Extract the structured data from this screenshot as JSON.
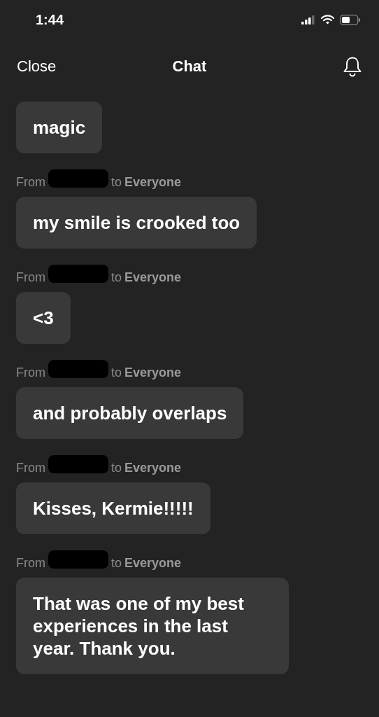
{
  "status_bar": {
    "time": "1:44"
  },
  "header": {
    "close": "Close",
    "title": "Chat"
  },
  "messages": [
    {
      "text": "magic"
    },
    {
      "from": "From",
      "to": "to",
      "recipient": "Everyone",
      "text": "my smile is crooked too"
    },
    {
      "from": "From",
      "to": "to",
      "recipient": "Everyone",
      "text": "<3"
    },
    {
      "from": "From",
      "to": "to",
      "recipient": "Everyone",
      "text": "and probably overlaps"
    },
    {
      "from": "From",
      "to": "to",
      "recipient": "Everyone",
      "text": "Kisses, Kermie!!!!!"
    },
    {
      "from": "From",
      "to": "to",
      "recipient": "Everyone",
      "text": "That was one of my best experiences in the last year.  Thank you."
    }
  ]
}
